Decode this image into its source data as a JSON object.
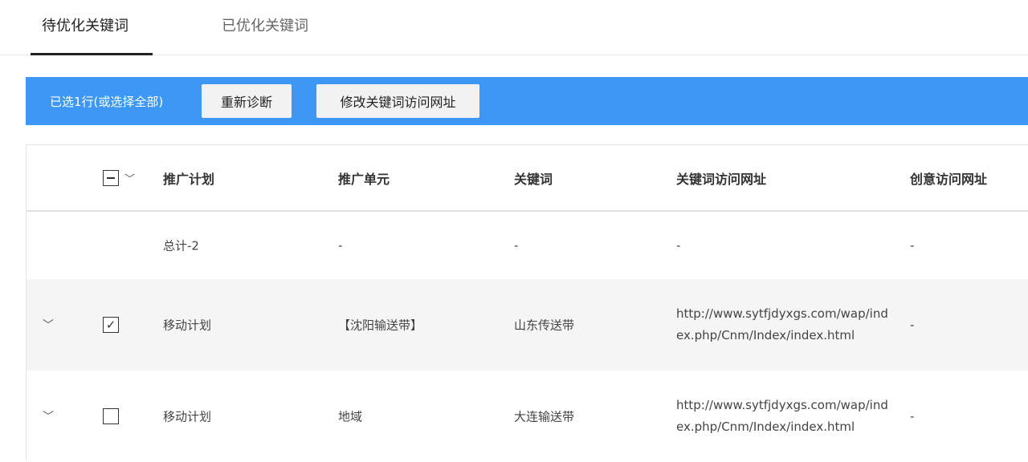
{
  "tabs": [
    {
      "label": "待优化关键词",
      "active": true
    },
    {
      "label": "已优化关键词",
      "active": false
    }
  ],
  "action_bar": {
    "selection_text": "已选1行(或选择全部)",
    "rediagnose_label": "重新诊断",
    "edit_url_label": "修改关键词访问网址",
    "color": "#3c97f5"
  },
  "table": {
    "headers": [
      "推广计划",
      "推广单元",
      "关键词",
      "关键词访问网址",
      "创意访问网址"
    ],
    "total": {
      "plan": "总计-2",
      "unit": "-",
      "keyword": "-",
      "url": "-",
      "creative_url": "-"
    },
    "rows": [
      {
        "checked": true,
        "plan": "移动计划",
        "unit": "【沈阳输送带】",
        "keyword": "山东传送带",
        "url": "http://www.sytfjdyxgs.com/wap/index.php/Cnm/Index/index.html",
        "creative_url": "-"
      },
      {
        "checked": false,
        "plan": "移动计划",
        "unit": "地域",
        "keyword": "大连输送带",
        "url": "http://www.sytfjdyxgs.com/wap/index.php/Cnm/Index/index.html",
        "creative_url": "-"
      }
    ]
  }
}
